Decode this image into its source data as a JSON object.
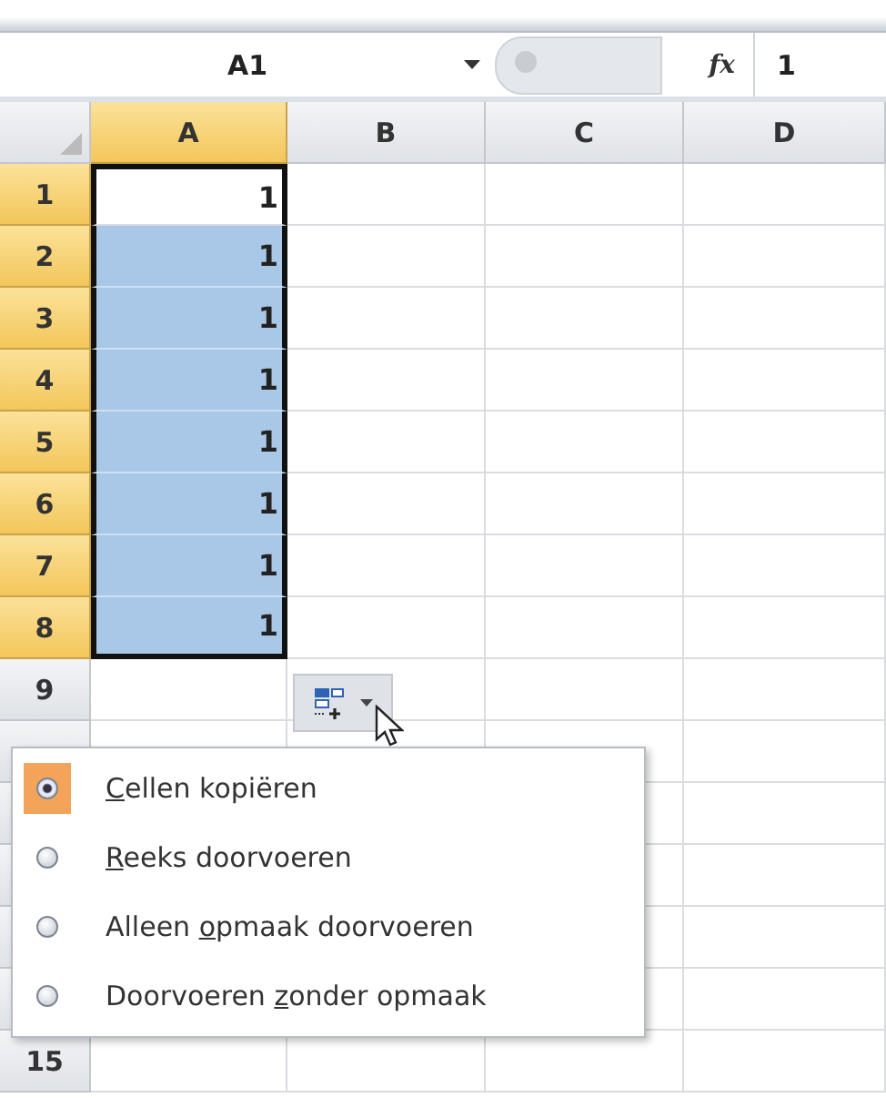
{
  "formula_bar": {
    "name_box": "A1",
    "function_label": "fx",
    "value": "1"
  },
  "columns": [
    {
      "label": "A",
      "selected": true
    },
    {
      "label": "B",
      "selected": false
    },
    {
      "label": "C",
      "selected": false
    },
    {
      "label": "D",
      "selected": false
    }
  ],
  "rows": [
    {
      "header": "1",
      "cells": [
        "1",
        "",
        "",
        ""
      ],
      "selected": true,
      "active": true
    },
    {
      "header": "2",
      "cells": [
        "1",
        "",
        "",
        ""
      ],
      "selected": true,
      "active": false
    },
    {
      "header": "3",
      "cells": [
        "1",
        "",
        "",
        ""
      ],
      "selected": true,
      "active": false
    },
    {
      "header": "4",
      "cells": [
        "1",
        "",
        "",
        ""
      ],
      "selected": true,
      "active": false
    },
    {
      "header": "5",
      "cells": [
        "1",
        "",
        "",
        ""
      ],
      "selected": true,
      "active": false
    },
    {
      "header": "6",
      "cells": [
        "1",
        "",
        "",
        ""
      ],
      "selected": true,
      "active": false
    },
    {
      "header": "7",
      "cells": [
        "1",
        "",
        "",
        ""
      ],
      "selected": true,
      "active": false
    },
    {
      "header": "8",
      "cells": [
        "1",
        "",
        "",
        ""
      ],
      "selected": true,
      "active": false
    },
    {
      "header": "9",
      "cells": [
        "",
        "",
        "",
        ""
      ],
      "selected": false,
      "active": false
    }
  ],
  "last_row": {
    "header": "15"
  },
  "autofill_menu": [
    {
      "key": "C",
      "after": "ellen kopiëren",
      "selected": true
    },
    {
      "key": "R",
      "after": "eeks doorvoeren",
      "selected": false
    },
    {
      "before": "Alleen ",
      "key": "o",
      "after": "pmaak doorvoeren",
      "selected": false
    },
    {
      "before": "Doorvoeren ",
      "key": "z",
      "after": "onder opmaak",
      "selected": false
    }
  ]
}
